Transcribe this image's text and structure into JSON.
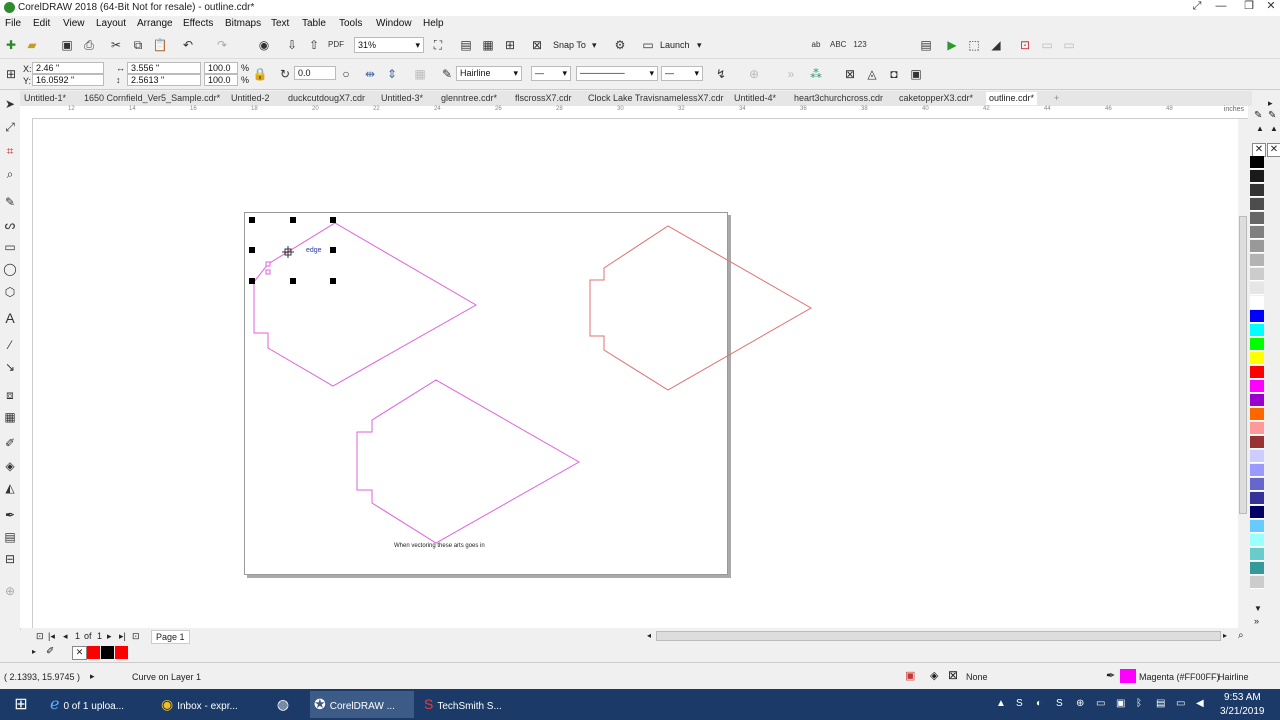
{
  "window": {
    "title": "CorelDRAW 2018 (64-Bit Not for resale) - outline.cdr*"
  },
  "menu": [
    "File",
    "Edit",
    "View",
    "Layout",
    "Arrange",
    "Effects",
    "Bitmaps",
    "Text",
    "Table",
    "Tools",
    "Window",
    "Help"
  ],
  "standard_toolbar": {
    "zoom_level": "31%",
    "snap_to_label": "Snap To",
    "launch_label": "Launch"
  },
  "property_bar": {
    "x_value": "2.46 \"",
    "y_value": "16.0592 \"",
    "width_value": "3.556 \"",
    "height_value": "2.5613 \"",
    "scale_x": "100.0",
    "scale_y": "100.0",
    "percent_sign": "%",
    "rotation": "0.0",
    "outline_width": "Hairline",
    "x_label": "X:",
    "y_label": "Y:"
  },
  "document_tabs": [
    {
      "label": "Untitled-1*",
      "active": false
    },
    {
      "label": "1650 Cornfield_Ver5_Sample.cdr*",
      "active": false
    },
    {
      "label": "Untitled-2",
      "active": false
    },
    {
      "label": "duckcutdougX7.cdr",
      "active": false
    },
    {
      "label": "Untitled-3*",
      "active": false
    },
    {
      "label": "glenntree.cdr*",
      "active": false
    },
    {
      "label": "flscrossX7.cdr",
      "active": false
    },
    {
      "label": "Clock Lake TravisnamelessX7.cdr",
      "active": false
    },
    {
      "label": "Untitled-4*",
      "active": false
    },
    {
      "label": "heart3churchcross.cdr",
      "active": false
    },
    {
      "label": "caketopperX3.cdr*",
      "active": false
    },
    {
      "label": "outline.cdr*",
      "active": true
    }
  ],
  "ruler": {
    "unit": "inches",
    "labels": [
      "12",
      "14",
      "16",
      "18",
      "20",
      "22",
      "24",
      "26",
      "28",
      "30",
      "32",
      "34",
      "36",
      "38",
      "40",
      "42",
      "44",
      "46",
      "48"
    ]
  },
  "canvas": {
    "tooltip_text": "edge",
    "caption": "When vectoring these arts goes in",
    "colors": {
      "magenta": "#e060e0",
      "red": "#e07070",
      "selection": "#000000"
    }
  },
  "page_nav": {
    "current": "1",
    "of_label": "of",
    "total": "1",
    "page_tab": "Page 1"
  },
  "status": {
    "coordinates": "( 2.1393, 15.9745 )",
    "object_info": "Curve on Layer 1",
    "fill_label": "None",
    "outline_color_label": "Magenta (#FF00FF)",
    "outline_width_label": "Hairline",
    "outline_color": "#ff00ff"
  },
  "taskbar": {
    "items": [
      {
        "label": "0 of 1 uploa...",
        "icon": "ie-icon",
        "active": false
      },
      {
        "label": "Inbox - expr...",
        "icon": "chrome-icon",
        "active": false
      },
      {
        "label": "",
        "icon": "app-icon",
        "active": false
      },
      {
        "label": "CorelDRAW ...",
        "icon": "coreldraw-icon",
        "active": true
      },
      {
        "label": "TechSmith S...",
        "icon": "techsmith-icon",
        "active": false
      }
    ],
    "time": "9:53 AM",
    "date": "3/21/2019"
  },
  "palette_colors": [
    "#000000",
    "#1a1a1a",
    "#333333",
    "#4d4d4d",
    "#666666",
    "#808080",
    "#999999",
    "#b3b3b3",
    "#cccccc",
    "#e6e6e6",
    "#ffffff",
    "#0000ff",
    "#00ffff",
    "#00ff00",
    "#ffff00",
    "#ff0000",
    "#ff00ff",
    "#9900cc",
    "#ff6600",
    "#ff9999",
    "#993333",
    "#ccccff",
    "#9999ff",
    "#6666cc",
    "#333399",
    "#000066",
    "#66ccff",
    "#99ffff",
    "#66cccc",
    "#339999",
    "#cccccc"
  ],
  "doc_palette_colors": [
    "#ff0000",
    "#000000",
    "#ff0000"
  ]
}
